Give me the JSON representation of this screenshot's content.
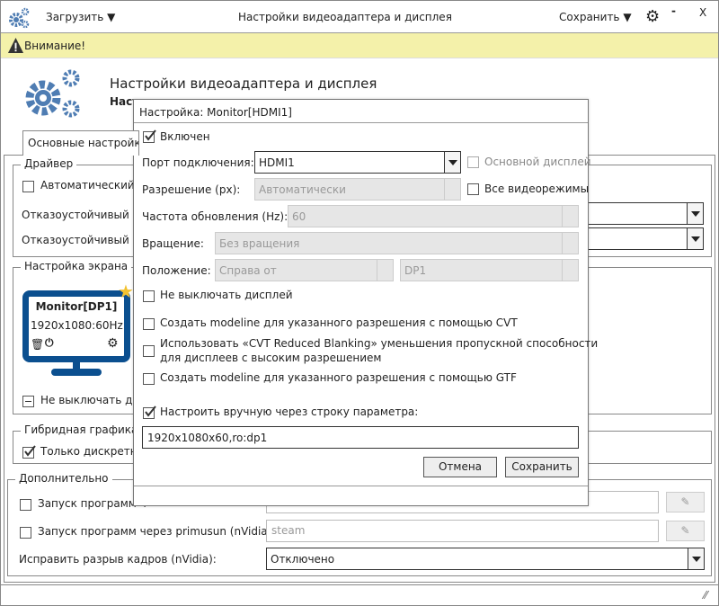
{
  "titlebar": {
    "load_label": "Загрузить",
    "title": "Настройки видеоадаптера и дисплея",
    "save_label": "Сохранить",
    "minimize": "-",
    "close": "X"
  },
  "warning": {
    "text": "Внимание!"
  },
  "header": {
    "title": "Настройки видеоадаптера и дисплея",
    "subtitle": "Наст"
  },
  "tabs": [
    {
      "label": "Основные настройки"
    }
  ],
  "driver": {
    "title": "Драйвер",
    "auto_label": "Автоматический в",
    "fallback1_label": "Отказоустойчивый др",
    "fallback2_label": "Отказоустойчивый др"
  },
  "screen": {
    "title": "Настройка экрана",
    "monitor_name": "Monitor[DP1]",
    "monitor_mode": "1920x1080:60Hz",
    "keep_on_label": "Не выключать ди"
  },
  "hybrid": {
    "title": "Гибридная графика",
    "discrete_label": "Только дискретно"
  },
  "extra": {
    "title": "Дополнительно",
    "row1_label": "Запуск программ ч",
    "row2_label": "Запуск программ через primusun (nVidia):",
    "row2_value": "steam",
    "tearing_label": "Исправить разрыв кадров (nVidia):",
    "tearing_value": "Отключено"
  },
  "dialog": {
    "title": "Настройка: Monitor[HDMI1]",
    "enabled_label": "Включен",
    "enabled": true,
    "port_label": "Порт подключения:",
    "port_value": "HDMI1",
    "primary_label": "Основной дисплей",
    "resolution_label": "Разрешение (px):",
    "resolution_value": "Автоматически",
    "allmodes_label": "Все видеорежимы",
    "refresh_label": "Частота обновления (Hz):",
    "refresh_value": "60",
    "rotation_label": "Вращение:",
    "rotation_value": "Без вращения",
    "position_label": "Положение:",
    "position_value": "Справа от",
    "position_target": "DP1",
    "keep_on_label": "Не выключать дисплей",
    "cvt_label": "Создать modeline для указанного разрешения с помощью CVT",
    "cvt_rb_label1": "Использовать «CVT Reduced Blanking» уменьшения пропускной способности",
    "cvt_rb_label2": "для дисплеев с высоким разрешением",
    "gtf_label": "Создать modeline для указанного разрешения с помощью GTF",
    "manual_label": "Настроить вручную через строку параметра:",
    "manual": true,
    "manual_value": "1920x1080x60,ro:dp1",
    "cancel_label": "Отмена",
    "save_label": "Сохранить"
  },
  "colors": {
    "accent": "#4f7db3",
    "monitor": "#0b4f8f",
    "warning_bg": "#f4f1aa",
    "star": "#f2c230"
  }
}
